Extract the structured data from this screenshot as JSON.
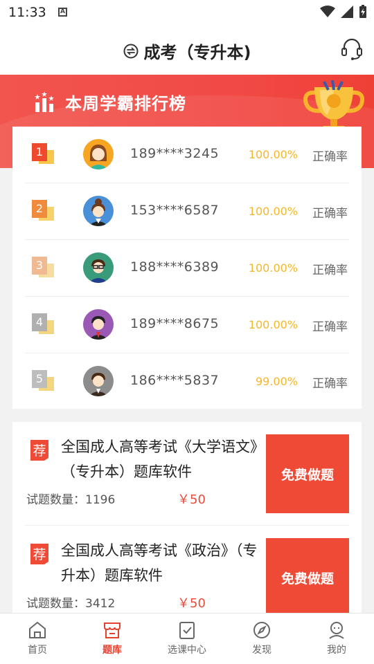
{
  "status_bar": {
    "time": "11:33"
  },
  "header": {
    "title": "成考（专升本)"
  },
  "banner": {
    "title": "本周学霸排行榜"
  },
  "ranking": {
    "rows": [
      {
        "rank": "1",
        "phone": "189****3245",
        "accuracy": "100.00%",
        "accuracy_label": "正确率",
        "front": "#ef4a2d",
        "back": "#f8c64a"
      },
      {
        "rank": "2",
        "phone": "153****6587",
        "accuracy": "100.00%",
        "accuracy_label": "正确率",
        "front": "#f08a3c",
        "back": "#f8d26a"
      },
      {
        "rank": "3",
        "phone": "188****6389",
        "accuracy": "100.00%",
        "accuracy_label": "正确率",
        "front": "#efb991",
        "back": "#f7dca0"
      },
      {
        "rank": "4",
        "phone": "189****8675",
        "accuracy": "100.00%",
        "accuracy_label": "正确率",
        "front": "#b0b0b0",
        "back": "#f5d680"
      },
      {
        "rank": "5",
        "phone": "186****5837",
        "accuracy": "99.00%",
        "accuracy_label": "正确率",
        "front": "#bdbdbd",
        "back": "#f5d680"
      }
    ]
  },
  "recommendations": [
    {
      "tag": "荐",
      "name": "全国成人高等考试《大学语文》（专升本）题库软件",
      "count_label": "试题数量：1196",
      "price": "￥50",
      "button": "免费做题"
    },
    {
      "tag": "荐",
      "name": "全国成人高等考试《政治》（专升本）题库软件",
      "count_label": "试题数量：3412",
      "price": "￥50",
      "button": "免费做题"
    }
  ],
  "tabs": [
    {
      "label": "首页",
      "icon": "home-icon"
    },
    {
      "label": "题库",
      "icon": "store-icon",
      "active": true
    },
    {
      "label": "选课中心",
      "icon": "checklist-icon"
    },
    {
      "label": "发现",
      "icon": "compass-icon"
    },
    {
      "label": "我的",
      "icon": "profile-icon"
    }
  ],
  "colors": {
    "accent": "#ee4a35",
    "percentage": "#f3b82b",
    "price": "#e84c3d"
  }
}
